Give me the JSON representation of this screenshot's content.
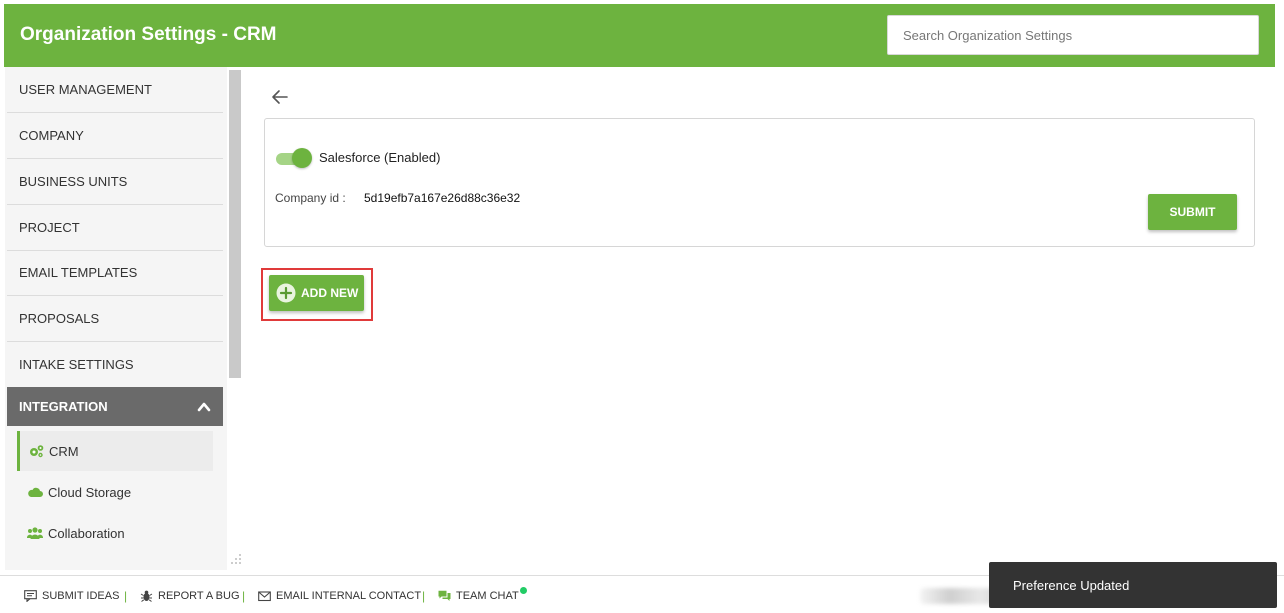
{
  "header": {
    "title": "Organization Settings - CRM",
    "search_placeholder": "Search Organization Settings"
  },
  "sidebar": {
    "items": [
      {
        "label": "User Management"
      },
      {
        "label": "Company"
      },
      {
        "label": "Business Units"
      },
      {
        "label": "Project"
      },
      {
        "label": "Email Templates"
      },
      {
        "label": "Proposals"
      },
      {
        "label": "Intake Settings"
      }
    ],
    "active_section": {
      "label": "Integration"
    },
    "sub_items": [
      {
        "label": "CRM",
        "icon": "gears-icon",
        "active": true
      },
      {
        "label": "Cloud Storage",
        "icon": "cloud-icon",
        "active": false
      },
      {
        "label": "Collaboration",
        "icon": "users-icon",
        "active": false
      }
    ]
  },
  "content": {
    "integration_label": "Salesforce (Enabled)",
    "toggle_enabled": true,
    "company_id_label": "Company id :",
    "company_id_value": "5d19efb7a167e26d88c36e32",
    "submit_label": "Submit",
    "add_new_label": "Add New"
  },
  "footer": {
    "items": [
      {
        "label": "Submit Ideas",
        "icon": "comment-icon"
      },
      {
        "label": "Report A Bug",
        "icon": "bug-icon"
      },
      {
        "label": "Email Internal Contact",
        "icon": "envelope-icon"
      },
      {
        "label": "Team Chat",
        "icon": "chat-icon"
      }
    ],
    "separator": "|"
  },
  "toast": {
    "message": "Preference Updated"
  },
  "colors": {
    "brand": "#6db33f",
    "active_nav": "#6a6a6a",
    "toast_bg": "#333333",
    "highlight": "#e03a3a",
    "online": "#22cc66"
  }
}
